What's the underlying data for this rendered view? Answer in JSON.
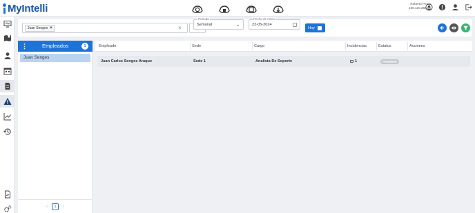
{
  "app": {
    "logo_text": "MyIntelli"
  },
  "user": {
    "name": "Roberto Perez",
    "ip": "190.120.255.56"
  },
  "filters": {
    "employee_chip": "Juan Senges",
    "period_label": "Periodo",
    "period_value": "Semanal",
    "start_date_label": "Fecha de inicio",
    "start_date_value": "22-05-2024",
    "today_button": "Hoy"
  },
  "employees": {
    "title": "Empleados",
    "count": "1",
    "items": [
      "Juan Senges"
    ],
    "page": "1"
  },
  "table": {
    "headers": [
      "Empleado",
      "Sede",
      "Cargo",
      "Incidencias",
      "Estatus",
      "Acciones"
    ],
    "rows": [
      {
        "empleado": "Juan Carlos Senges Araque",
        "sede": "Sede 1",
        "cargo": "Analista De Soporte",
        "incidencias": "1",
        "estatus": "Pendiente"
      }
    ]
  },
  "colors": {
    "primary": "#1e73d8",
    "header_blue": "#1b55b0",
    "filter_green": "#3cb371",
    "eye_dark": "#555555"
  }
}
